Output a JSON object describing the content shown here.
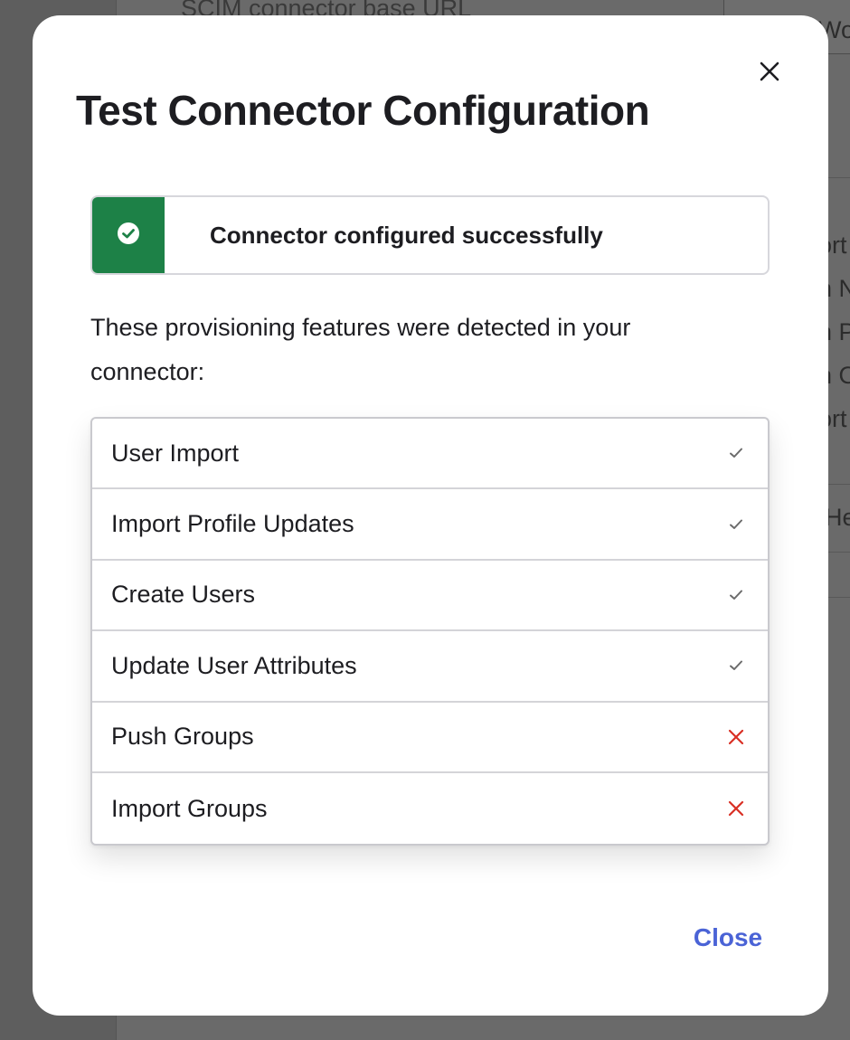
{
  "background": {
    "fragments": [
      "SCIM connector base URL",
      "Wo",
      "ort",
      "n N",
      "n P",
      "n O",
      "ort",
      "He"
    ]
  },
  "modal": {
    "title": "Test Connector Configuration",
    "close_icon": "close-icon",
    "alert": {
      "icon": "check-circle-icon",
      "message": "Connector configured successfully",
      "color": "#1d8147"
    },
    "description": "These provisioning features were detected in your connector:",
    "features": [
      {
        "label": "User Import",
        "status": "supported",
        "icon": "checkmark-icon"
      },
      {
        "label": "Import Profile Updates",
        "status": "supported",
        "icon": "checkmark-icon"
      },
      {
        "label": "Create Users",
        "status": "supported",
        "icon": "checkmark-icon"
      },
      {
        "label": "Update User Attributes",
        "status": "supported",
        "icon": "checkmark-icon"
      },
      {
        "label": "Push Groups",
        "status": "unsupported",
        "icon": "cross-icon"
      },
      {
        "label": "Import Groups",
        "status": "unsupported",
        "icon": "cross-icon"
      }
    ],
    "close_button": "Close",
    "colors": {
      "accent": "#4a63d6",
      "error": "#d93025",
      "check": "#6b6b6b"
    }
  }
}
